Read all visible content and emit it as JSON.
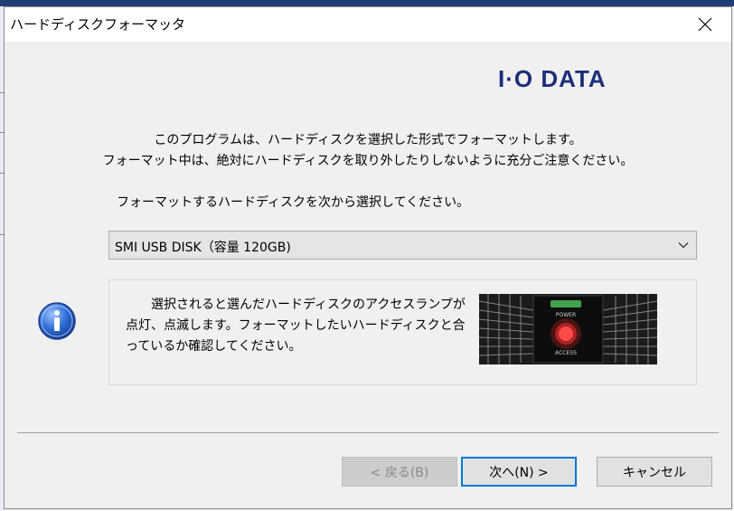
{
  "window": {
    "title": "ハードディスクフォーマッタ",
    "close_icon": "close-icon"
  },
  "brand": {
    "logo_text": "I·O DATA"
  },
  "intro": {
    "line1": "このプログラムは、ハードディスクを選択した形式でフォーマットします。",
    "line2": "フォーマット中は、絶対にハードディスクを取り外したりしないように充分ご注意ください。"
  },
  "prompt": "フォーマットするハードディスクを次から選択してください。",
  "disk_select": {
    "selected": "SMI USB DISK（容量 120GB)",
    "icon": "chevron-down-icon"
  },
  "info": {
    "icon": "info-icon",
    "text": "選択されると選んだハードディスクのアクセスランプが点灯、点滅します。フォーマットしたいハードディスクと合っているか確認してください。",
    "image_labels": {
      "power": "POWER",
      "access": "ACCESS"
    }
  },
  "buttons": {
    "back": "< 戻る(B)",
    "next": "次へ(N) >",
    "cancel": "キャンセル"
  },
  "colors": {
    "logo": "#1c2f7a",
    "default_button_border": "#0078d7",
    "access_lamp": "#ff2a2a",
    "power_lamp": "#3fa34d"
  }
}
